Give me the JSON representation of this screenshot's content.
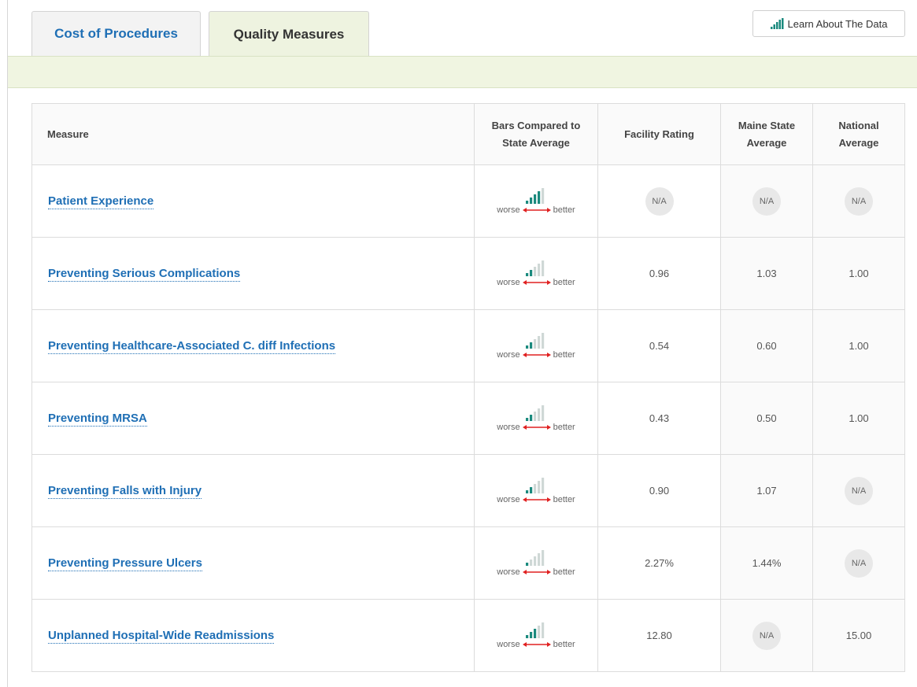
{
  "tabs": [
    {
      "label": "Cost of Procedures",
      "active": false
    },
    {
      "label": "Quality Measures",
      "active": true
    }
  ],
  "learn_button": {
    "label": "Learn About The Data",
    "icon": "signal-bars-icon"
  },
  "table": {
    "headers": {
      "measure": "Measure",
      "bars_line1": "Bars Compared to",
      "bars_line2": "State Average",
      "facility": "Facility Rating",
      "state_line1": "Maine State",
      "state_line2": "Average",
      "national_line1": "National",
      "national_line2": "Average"
    },
    "scale": {
      "worse": "worse",
      "better": "better"
    },
    "rows": [
      {
        "measure": "Patient Experience",
        "bars": 4,
        "facility": "N/A",
        "state": "N/A",
        "national": "N/A"
      },
      {
        "measure": "Preventing Serious Complications",
        "bars": 2,
        "facility": "0.96",
        "state": "1.03",
        "national": "1.00"
      },
      {
        "measure": "Preventing Healthcare-Associated C. diff Infections",
        "bars": 2,
        "facility": "0.54",
        "state": "0.60",
        "national": "1.00"
      },
      {
        "measure": "Preventing MRSA",
        "bars": 2,
        "facility": "0.43",
        "state": "0.50",
        "national": "1.00"
      },
      {
        "measure": "Preventing Falls with Injury",
        "bars": 2,
        "facility": "0.90",
        "state": "1.07",
        "national": "N/A"
      },
      {
        "measure": "Preventing Pressure Ulcers",
        "bars": 1,
        "facility": "2.27%",
        "state": "1.44%",
        "national": "N/A"
      },
      {
        "measure": "Unplanned Hospital-Wide Readmissions",
        "bars": 3,
        "facility": "12.80",
        "state": "N/A",
        "national": "15.00"
      }
    ]
  },
  "colors": {
    "bar_active": "#1b8a7e",
    "bar_inactive": "#cfd8d6",
    "scale_arrow": "#e02020",
    "link": "#1f6fb5",
    "green_band": "#f0f5e1"
  }
}
